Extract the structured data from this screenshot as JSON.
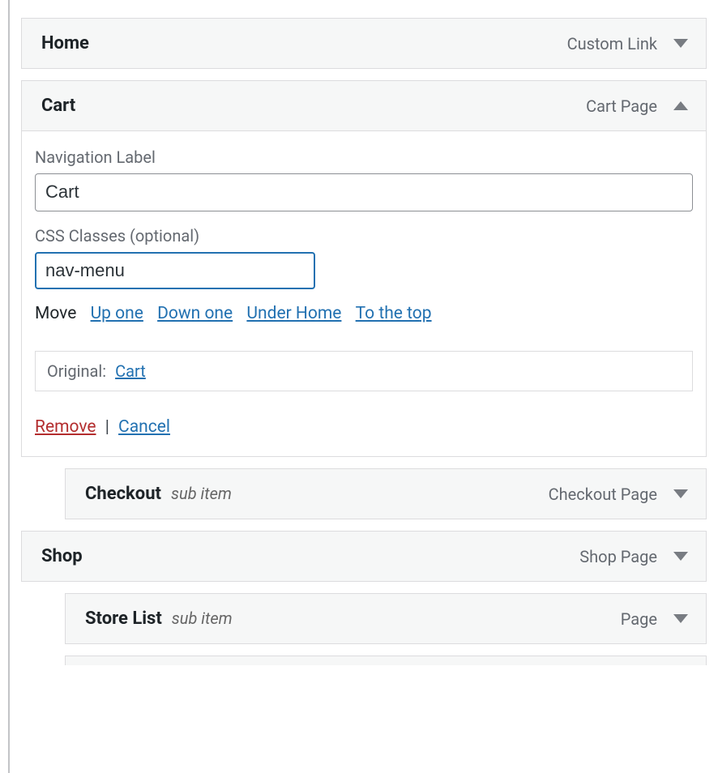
{
  "items": {
    "home": {
      "title": "Home",
      "type": "Custom Link",
      "sub": "",
      "expanded": false
    },
    "cart": {
      "title": "Cart",
      "type": "Cart Page",
      "sub": "",
      "expanded": true
    },
    "checkout": {
      "title": "Checkout",
      "type": "Checkout Page",
      "sub": "sub item",
      "expanded": false
    },
    "shop": {
      "title": "Shop",
      "type": "Shop Page",
      "sub": "",
      "expanded": false
    },
    "storelist": {
      "title": "Store List",
      "type": "Page",
      "sub": "sub item",
      "expanded": false
    }
  },
  "cartSettings": {
    "navLabelField": "Navigation Label",
    "navLabelValue": "Cart",
    "cssField": "CSS Classes (optional)",
    "cssValue": "nav-menu",
    "moveLabel": "Move",
    "moveUp": "Up one",
    "moveDown": "Down one",
    "moveUnder": "Under Home",
    "moveTop": "To the top",
    "originalLabel": "Original:",
    "originalLink": "Cart",
    "remove": "Remove",
    "sep": " | ",
    "cancel": "Cancel"
  }
}
